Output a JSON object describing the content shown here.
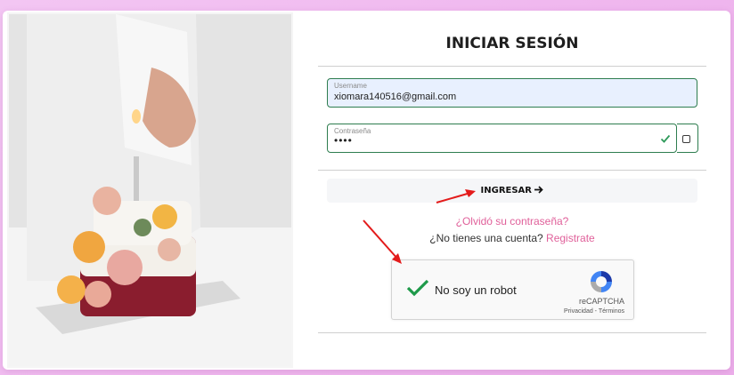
{
  "login": {
    "title": "INICIAR SESIÓN",
    "username_label": "Username",
    "username_value": "xiomara140516@gmail.com",
    "password_label": "Contraseña",
    "password_value": "••••",
    "submit_label": "INGRESAR",
    "forgot_link": "¿Olvidó su contraseña?",
    "no_account_text": "¿No tienes una cuenta?",
    "register_link": "Registrate"
  },
  "recaptcha": {
    "label": "No soy un robot",
    "brand": "reCAPTCHA",
    "terms": "Privacidad - Términos",
    "checked": true
  },
  "colors": {
    "accent_green": "#2e7d4f",
    "link_pink": "#e0609a",
    "annotation_red": "#e31b1b",
    "background": "#f0b8ef"
  },
  "icons": [
    "check-icon",
    "checkbox-icon",
    "arrow-right-icon",
    "recaptcha-logo-icon",
    "annotation-arrow"
  ]
}
